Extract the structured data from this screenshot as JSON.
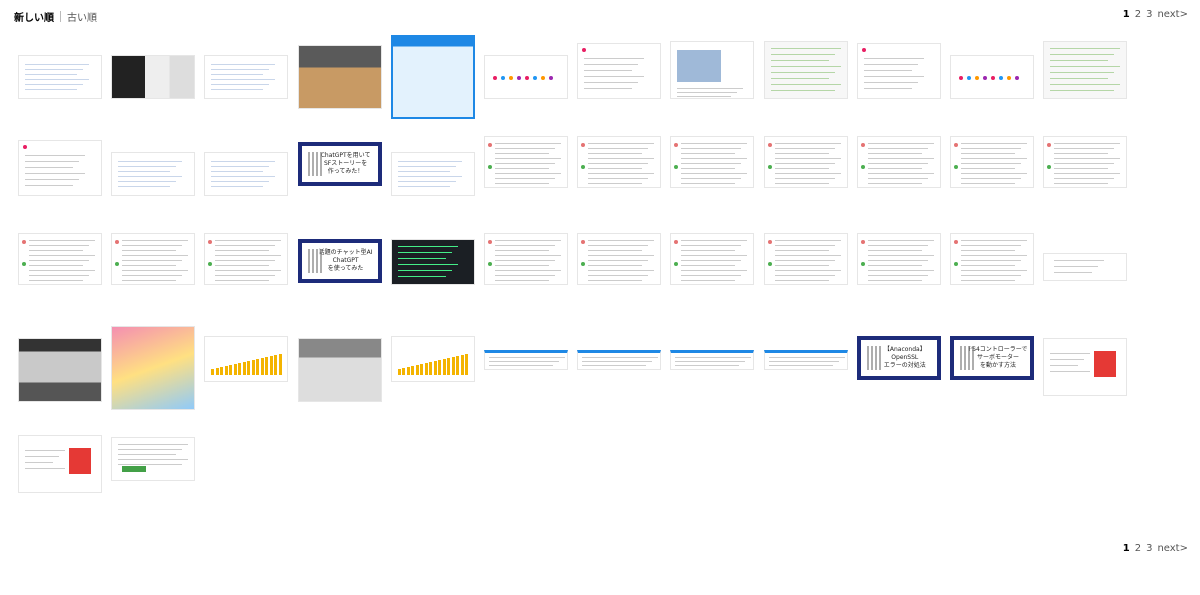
{
  "sort": {
    "active": "新しい順",
    "other": "古い順"
  },
  "pagination": {
    "pages": [
      "1",
      "2",
      "3"
    ],
    "current": "1",
    "next": "next>"
  },
  "accent": "#1d2b7a",
  "tiles": [
    {
      "kind": "doc"
    },
    {
      "kind": "photo-dark"
    },
    {
      "kind": "doc"
    },
    {
      "kind": "photo-desk"
    },
    {
      "kind": "poster-blue"
    },
    {
      "kind": "colorful"
    },
    {
      "kind": "social"
    },
    {
      "kind": "social-img"
    },
    {
      "kind": "chat"
    },
    {
      "kind": "social"
    },
    {
      "kind": "colorful"
    },
    {
      "kind": "chat"
    },
    {
      "kind": "social"
    },
    {
      "kind": "doc"
    },
    {
      "kind": "doc"
    },
    {
      "kind": "banner",
      "title": "ChatGPTを用いて\nSFストーリーを\n作ってみた！"
    },
    {
      "kind": "doc"
    },
    {
      "kind": "text"
    },
    {
      "kind": "text"
    },
    {
      "kind": "text"
    },
    {
      "kind": "text"
    },
    {
      "kind": "text"
    },
    {
      "kind": "text"
    },
    {
      "kind": "text"
    },
    {
      "kind": "text"
    },
    {
      "kind": "text"
    },
    {
      "kind": "text"
    },
    {
      "kind": "banner",
      "title": "話題のチャット型AI\nChatGPT\nを使ってみた"
    },
    {
      "kind": "terminal"
    },
    {
      "kind": "text"
    },
    {
      "kind": "text"
    },
    {
      "kind": "text"
    },
    {
      "kind": "text"
    },
    {
      "kind": "text"
    },
    {
      "kind": "text"
    },
    {
      "kind": "small"
    },
    {
      "kind": "photo-shop"
    },
    {
      "kind": "poster-anime"
    },
    {
      "kind": "chart"
    },
    {
      "kind": "photo-keyboard"
    },
    {
      "kind": "chart"
    },
    {
      "kind": "table"
    },
    {
      "kind": "table"
    },
    {
      "kind": "table"
    },
    {
      "kind": "table"
    },
    {
      "kind": "banner",
      "title": "【Anaconda】\nOpenSSL\nエラーの対処法"
    },
    {
      "kind": "banner",
      "title": "PS4コントローラーで\nサーボモーター\nを動かす方法"
    },
    {
      "kind": "web-red"
    },
    {
      "kind": "web-red"
    },
    {
      "kind": "web-green"
    }
  ]
}
